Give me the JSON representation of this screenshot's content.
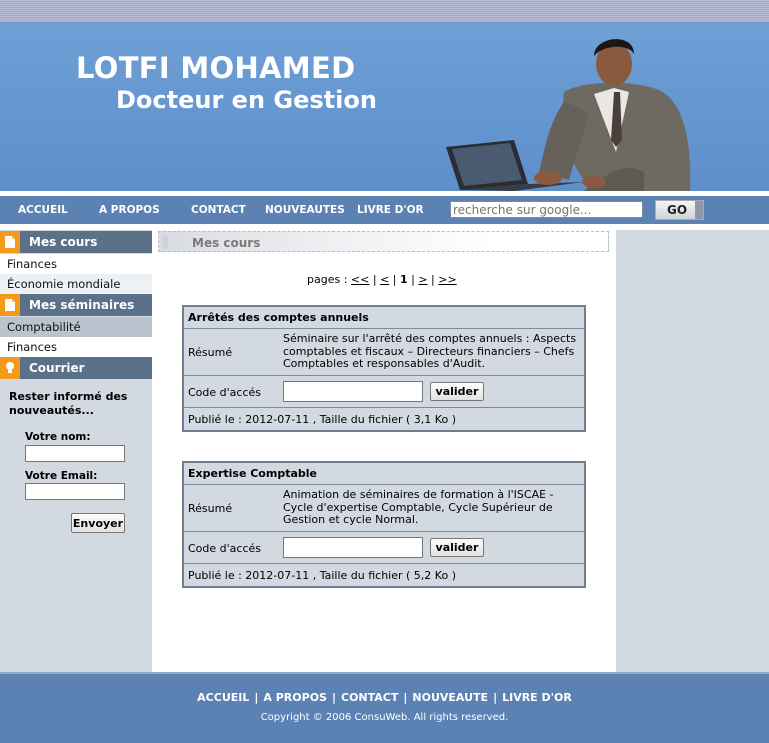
{
  "header": {
    "name": "LOTFI MOHAMED",
    "subtitle": "Docteur en Gestion"
  },
  "nav": {
    "items": [
      "ACCUEIL",
      "A PROPOS",
      "CONTACT",
      "NOUVEAUTES",
      "LIVRE D'OR"
    ],
    "search_placeholder": "recherche sur google...",
    "go_label": "GO"
  },
  "sidebar": {
    "courses_title": "Mes cours",
    "courses": [
      "Finances",
      "Économie mondiale"
    ],
    "seminars_title": "Mes séminaires",
    "seminars": [
      "Comptabilité",
      "Finances"
    ],
    "mail_title": "Courrier",
    "newsletter_text": "Rester informé des nouveautés...",
    "name_label": "Votre nom:",
    "email_label": "Votre Email:",
    "send_label": "Envoyer"
  },
  "main": {
    "section_title": "Mes cours",
    "pagination": {
      "prefix": "pages :",
      "first": "<<",
      "prev": "<",
      "current": "1",
      "next": ">",
      "last": ">>"
    },
    "cards": [
      {
        "title": "Arrêtés des comptes annuels",
        "resume_label": "Résumé",
        "resume": "Séminaire sur l'arrêté des comptes annuels : Aspects comptables et fiscaux – Directeurs financiers – Chefs Comptables et responsables d'Audit.",
        "code_label": "Code d'accés",
        "button_label": "valider",
        "published": "Publié le : 2012-07-11 , Taille du fichier ( 3,1 Ko )"
      },
      {
        "title": "Expertise Comptable",
        "resume_label": "Résumé",
        "resume": "Animation de séminaires de formation à l'ISCAE - Cycle d'expertise Comptable, Cycle Supérieur de Gestion et cycle Normal.",
        "code_label": "Code d'accés",
        "button_label": "valider",
        "published": "Publié le : 2012-07-11 , Taille du fichier ( 5,2 Ko )"
      }
    ]
  },
  "footer": {
    "links": [
      "ACCUEIL",
      "A PROPOS",
      "CONTACT",
      "NOUVEAUTE",
      "LIVRE D'OR"
    ],
    "separator": "|",
    "copyright": "Copyright © 2006 ConsuWeb. All rights reserved."
  },
  "colors": {
    "banner": "#6f9fd6",
    "nav": "#5b82b3",
    "sidebar_head": "#5a7189",
    "icon_accent": "#f39a1b"
  }
}
